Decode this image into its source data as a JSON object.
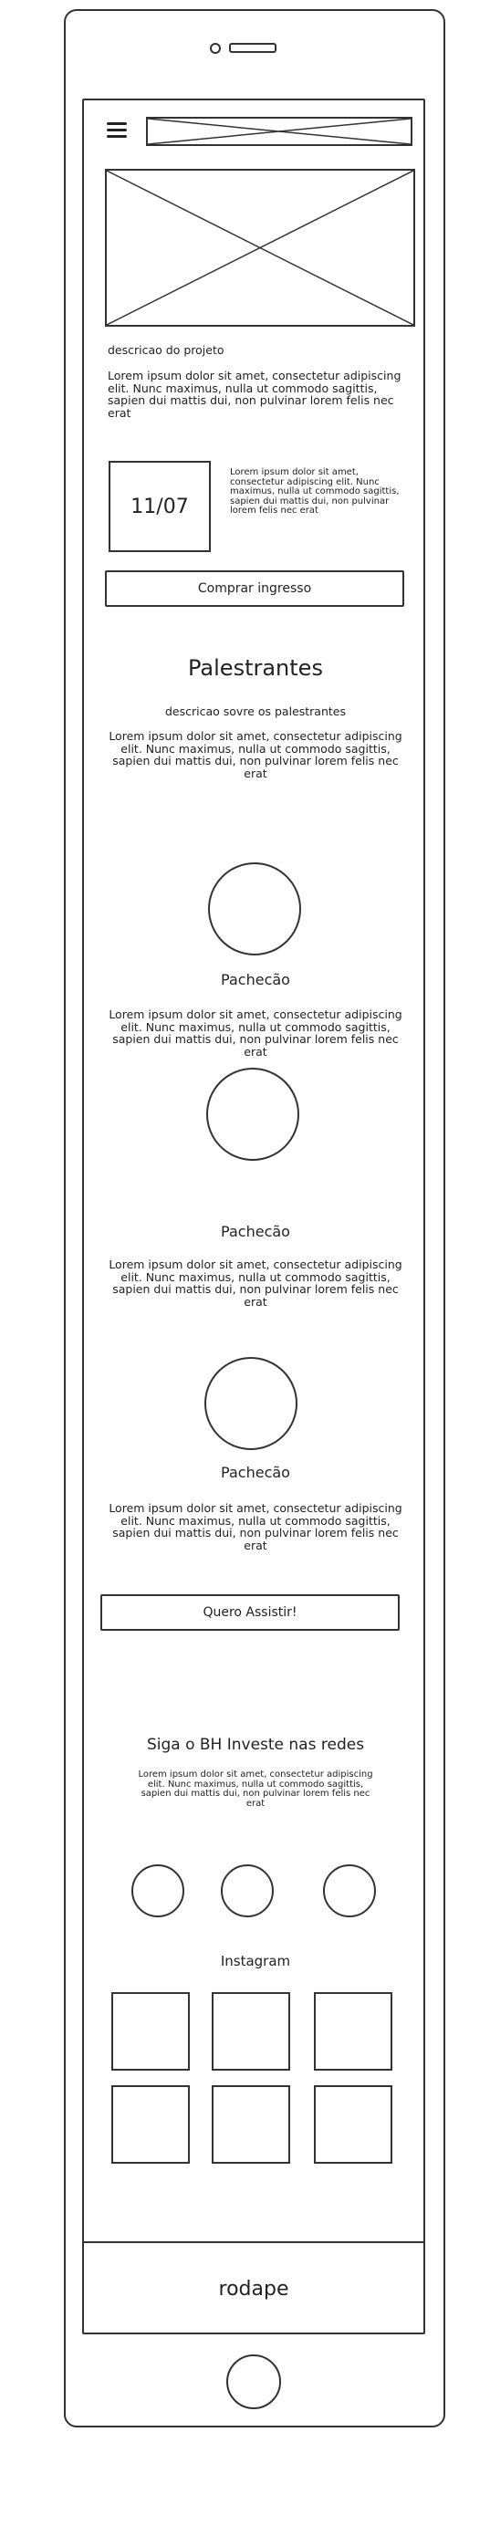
{
  "header": {
    "project_label": "descricao do projeto",
    "project_text": "Lorem ipsum dolor sit amet, consectetur adipiscing elit. Nunc maximus, nulla ut commodo sagittis, sapien dui mattis dui, non pulvinar lorem felis nec erat"
  },
  "event": {
    "date": "11/07",
    "text": "Lorem ipsum dolor sit amet, consectetur adipiscing elit. Nunc maximus, nulla ut commodo sagittis, sapien dui mattis dui, non pulvinar lorem felis nec erat",
    "buy_label": "Comprar ingresso"
  },
  "speakers": {
    "title": "Palestrantes",
    "subtitle": "descricao sovre os palestrantes",
    "intro": "Lorem ipsum dolor sit amet, consectetur adipiscing elit. Nunc maximus, nulla ut commodo sagittis, sapien dui mattis dui, non pulvinar lorem felis nec erat",
    "items": [
      {
        "name": "Pachecão",
        "bio": "Lorem ipsum dolor sit amet, consectetur adipiscing elit. Nunc maximus, nulla ut commodo sagittis, sapien dui mattis dui, non pulvinar lorem felis nec erat"
      },
      {
        "name": "Pachecão",
        "bio": "Lorem ipsum dolor sit amet, consectetur adipiscing elit. Nunc maximus, nulla ut commodo sagittis, sapien dui mattis dui, non pulvinar lorem felis nec erat"
      },
      {
        "name": "Pachecão",
        "bio": "Lorem ipsum dolor sit amet, consectetur adipiscing elit. Nunc maximus, nulla ut commodo sagittis, sapien dui mattis dui, non pulvinar lorem felis nec erat"
      }
    ],
    "cta_label": "Quero Assistir!"
  },
  "social": {
    "title": "Siga o BH Investe nas redes",
    "text": "Lorem ipsum dolor sit amet, consectetur adipiscing elit. Nunc maximus, nulla ut commodo sagittis, sapien dui mattis dui, non pulvinar lorem felis nec erat",
    "instagram_label": "Instagram"
  },
  "footer": {
    "label": "rodape"
  },
  "icons": {
    "menu": "hamburger-menu-icon"
  }
}
